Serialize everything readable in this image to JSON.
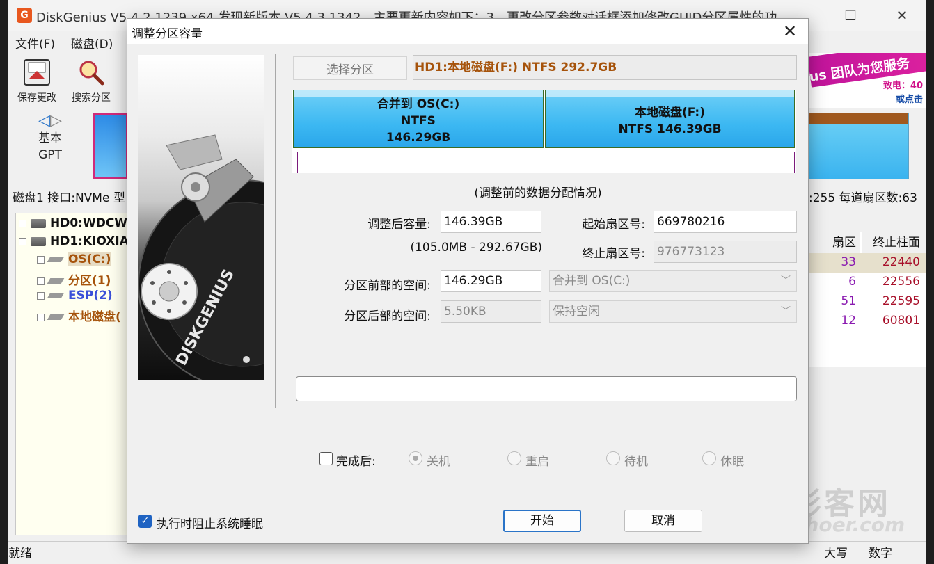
{
  "app": {
    "title": "DiskGenius V5.4.2.1239 x64   发现新版本 V5.4.3.1342，主要更新内容如下：3、更改分区参数对话框添加修改GUID分区属性的功",
    "icon_letter": "G",
    "window_controls": [
      "—",
      "☐",
      "✕"
    ]
  },
  "menu": {
    "file": "文件(F)",
    "disk": "磁盘(D)"
  },
  "toolbar": {
    "save": "保存更改",
    "search": "搜索分区"
  },
  "banner": {
    "text": "us 团队为您服务",
    "phone": "致电：40",
    "click": "或点击"
  },
  "disk_nav": {
    "type": "基本",
    "scheme": "GPT"
  },
  "disk_info": {
    "left": "磁盘1 接口:NVMe  型",
    "right": ":255  每道扇区数:63"
  },
  "tree": {
    "nodes": [
      {
        "label": "HD0:WDCW",
        "kind": "disk"
      },
      {
        "label": "HD1:KIOXIA",
        "kind": "disk"
      },
      {
        "label": "OS(C:)",
        "kind": "part",
        "color": "#a6530b"
      },
      {
        "label": "分区(1)",
        "kind": "part",
        "color": "#a6530b"
      },
      {
        "label": "ESP(2)",
        "kind": "part",
        "color": "#3a4fd8"
      },
      {
        "label": "本地磁盘(",
        "kind": "part",
        "color": "#a6530b"
      }
    ]
  },
  "grid": {
    "headers": [
      "扇区",
      "终止柱面"
    ],
    "rows": [
      [
        "33",
        "22440"
      ],
      [
        "6",
        "22556"
      ],
      [
        "51",
        "22595"
      ],
      [
        "12",
        "60801"
      ]
    ]
  },
  "status": {
    "text": "就绪",
    "caps": "大写",
    "num": "数字"
  },
  "watermark": {
    "cn": "影客网",
    "en": "Phoer.com"
  },
  "dialog": {
    "title": "调整分区容量",
    "close_icon": "✕",
    "art_logo_text": "DISKGENIUS",
    "select_button": "选择分区",
    "selected_partition": "HD1:本地磁盘(F:) NTFS 292.7GB",
    "segments": [
      {
        "lines": [
          "合并到 OS(C:)",
          "NTFS",
          "146.29GB"
        ]
      },
      {
        "lines": [
          "本地磁盘(F:)",
          "NTFS 146.39GB"
        ]
      }
    ],
    "note": "(调整前的数据分配情况)",
    "resize_label": "调整后容量:",
    "resize_value": "146.39GB",
    "range_text": "(105.0MB - 292.67GB)",
    "start_sector_label": "起始扇区号:",
    "start_sector_value": "669780216",
    "end_sector_label": "终止扇区号:",
    "end_sector_value": "976773123",
    "front_space_label": "分区前部的空间:",
    "front_space_value": "146.29GB",
    "front_space_action": "合并到 OS(C:)",
    "back_space_label": "分区后部的空间:",
    "back_space_value": "5.50KB",
    "back_space_action": "保持空闲",
    "progress": 0,
    "after_label": "完成后:",
    "after_options": [
      "关机",
      "重启",
      "待机",
      "休眠"
    ],
    "selected_option_index": 0,
    "prevent_sleep_label": "执行时阻止系统睡眠",
    "start_button": "开始",
    "cancel_button": "取消"
  }
}
